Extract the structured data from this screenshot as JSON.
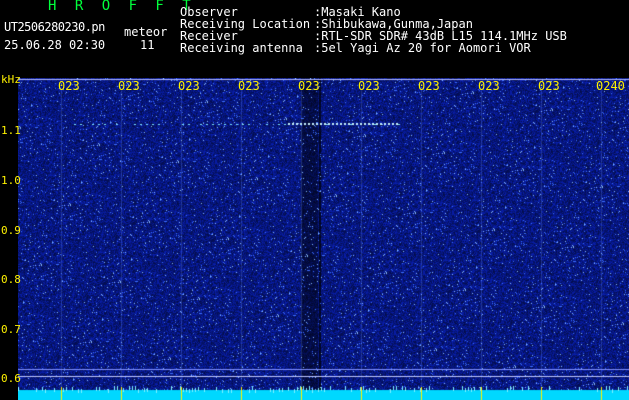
{
  "header": {
    "app_title": "H R O F F T",
    "file_name": "UT2506280230.pn",
    "meteor_label": "meteor",
    "datetime": "25.06.28 02:30",
    "meteor_count": "11"
  },
  "info": [
    {
      "label": "Observer",
      "value": ":Masaki Kano"
    },
    {
      "label": "Receiving Location",
      "value": ":Shibukawa,Gunma,Japan"
    },
    {
      "label": "Receiver",
      "value": ":RTL-SDR SDR# 43dB L15 114.1MHz USB"
    },
    {
      "label": "Receiving antenna",
      "value": ":5el Yagi Az 20 for Aomori VOR"
    }
  ],
  "axis": {
    "y_unit": "kHz",
    "y_ticks": [
      "1.1",
      "1.0",
      "0.9",
      "0.8",
      "0.7",
      "0.6"
    ],
    "time_ticks": [
      "023",
      "023",
      "023",
      "023",
      "023",
      "023",
      "023",
      "023",
      "023",
      "0240"
    ]
  },
  "colors": {
    "background": "#000000",
    "spectrum_blue": "#1a2fc0",
    "header_green": "#00ff3c",
    "axis_yellow": "#fff200",
    "text_white": "#ffffff"
  }
}
